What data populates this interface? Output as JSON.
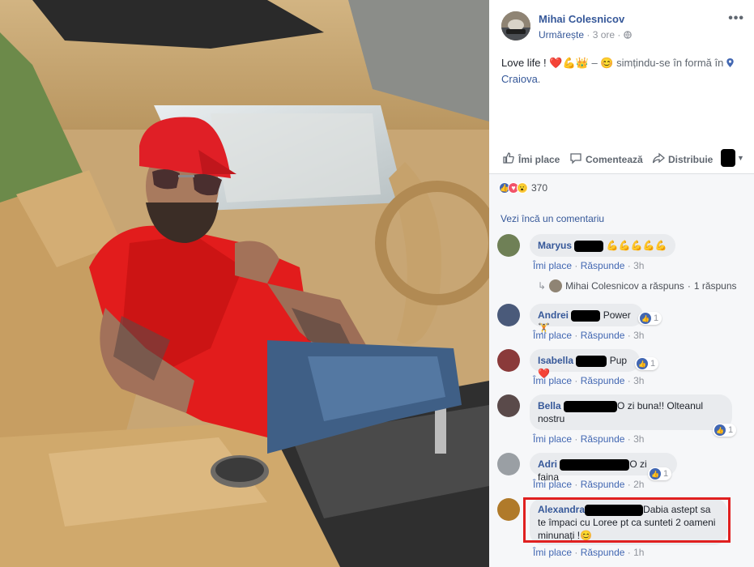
{
  "post": {
    "author": "Mihai Colesnicov",
    "follow_label": "Urmărește",
    "time": "3 ore",
    "text_main": "Love life !",
    "text_emoji": "❤️💪👑",
    "feeling": "simțindu-se în formă în",
    "location": "Craiova",
    "more_icon": "more-dots-icon",
    "privacy_icon": "globe-icon",
    "location_icon": "location-pin-icon"
  },
  "actions": {
    "like_label": "Îmi place",
    "comment_label": "Comentează",
    "share_label": "Distribuie"
  },
  "reactions": {
    "count": "370"
  },
  "comments_section": {
    "more_label": "Vezi încă un comentariu",
    "items": [
      {
        "name": "Maryus",
        "text": "💪💪💪💪💪",
        "like": "Îmi place",
        "reply": "Răspunde",
        "time": "3h",
        "likes": ""
      },
      {
        "name": "Andrei",
        "text": "Power🏋️",
        "like": "Îmi place",
        "reply": "Răspunde",
        "time": "3h",
        "likes": "1"
      },
      {
        "name": "Isabella",
        "text": "Pup ❤️",
        "like": "Îmi place",
        "reply": "Răspunde",
        "time": "3h",
        "likes": "1"
      },
      {
        "name": "Bella",
        "text_a": "O zi buna!! Olteanul",
        "text_b": "nostru",
        "like": "Îmi place",
        "reply": "Răspunde",
        "time": "3h",
        "likes": "1"
      },
      {
        "name": "Adri",
        "text": "O zi faina",
        "like": "Îmi place",
        "reply": "Răspunde",
        "time": "2h",
        "likes": "1"
      },
      {
        "name": "Alexandra",
        "text_a": "Dabia astept sa",
        "text_b": "te împaci cu Loree pt ca sunteti 2 oameni",
        "text_c": "minunați !😊",
        "like": "Îmi place",
        "reply": "Răspunde",
        "time": "1h",
        "likes": ""
      }
    ],
    "reply_row": {
      "text": "Mihai Colesnicov a răspuns",
      "count": "1 răspuns"
    }
  }
}
